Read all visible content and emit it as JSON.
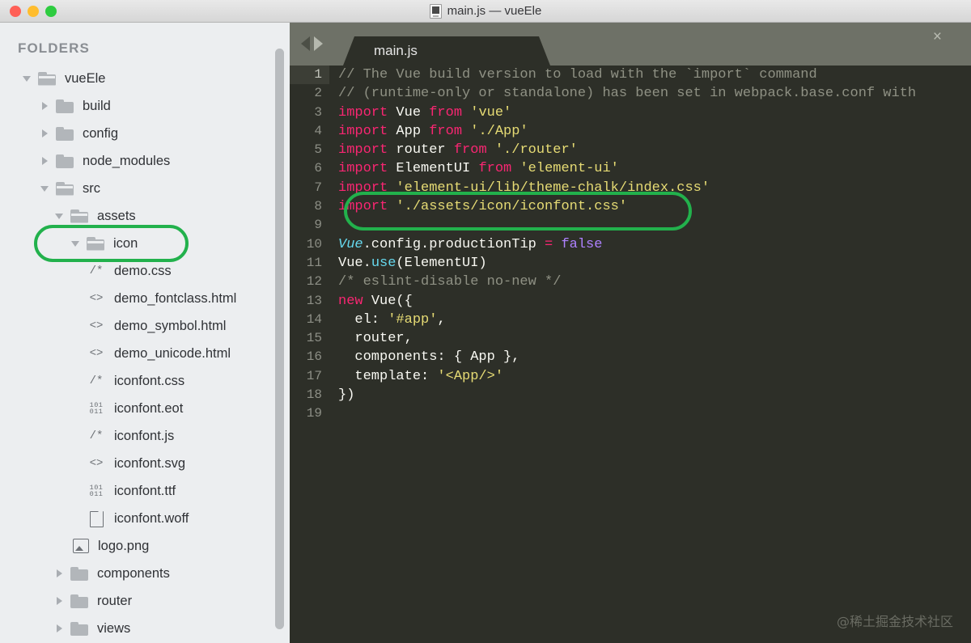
{
  "window": {
    "title": "main.js — vueEle",
    "title_icon": "document-icon",
    "traffic_lights": [
      {
        "name": "close",
        "color": "#ff5f56"
      },
      {
        "name": "minimize",
        "color": "#ffbd2e"
      },
      {
        "name": "zoom",
        "color": "#2ecc40"
      }
    ]
  },
  "sidebar": {
    "header": "FOLDERS",
    "tree": [
      {
        "label": "vueEle",
        "icon": "folder-open-icon",
        "twist": "down",
        "indent": 0
      },
      {
        "label": "build",
        "icon": "folder-icon",
        "twist": "right",
        "indent": 1
      },
      {
        "label": "config",
        "icon": "folder-icon",
        "twist": "right",
        "indent": 1
      },
      {
        "label": "node_modules",
        "icon": "folder-icon",
        "twist": "right",
        "indent": 1
      },
      {
        "label": "src",
        "icon": "folder-open-icon",
        "twist": "down",
        "indent": 1
      },
      {
        "label": "assets",
        "icon": "folder-open-icon",
        "twist": "down",
        "indent": 2
      },
      {
        "label": "icon",
        "icon": "folder-open-icon",
        "twist": "down",
        "indent": 3,
        "highlighted": true
      },
      {
        "label": "demo.css",
        "icon": "css-file-icon",
        "glyph": "/*",
        "indent": 4
      },
      {
        "label": "demo_fontclass.html",
        "icon": "html-file-icon",
        "glyph": "<>",
        "indent": 4
      },
      {
        "label": "demo_symbol.html",
        "icon": "html-file-icon",
        "glyph": "<>",
        "indent": 4
      },
      {
        "label": "demo_unicode.html",
        "icon": "html-file-icon",
        "glyph": "<>",
        "indent": 4
      },
      {
        "label": "iconfont.css",
        "icon": "css-file-icon",
        "glyph": "/*",
        "indent": 4
      },
      {
        "label": "iconfont.eot",
        "icon": "binary-file-icon",
        "glyph": "101 011",
        "indent": 4
      },
      {
        "label": "iconfont.js",
        "icon": "css-file-icon",
        "glyph": "/*",
        "indent": 4
      },
      {
        "label": "iconfont.svg",
        "icon": "html-file-icon",
        "glyph": "<>",
        "indent": 4
      },
      {
        "label": "iconfont.ttf",
        "icon": "binary-file-icon",
        "glyph": "101 011",
        "indent": 4
      },
      {
        "label": "iconfont.woff",
        "icon": "blank-file-icon",
        "glyph": "",
        "indent": 4
      },
      {
        "label": "logo.png",
        "icon": "image-file-icon",
        "glyph": "",
        "indent": 3
      },
      {
        "label": "components",
        "icon": "folder-icon",
        "twist": "right",
        "indent": 2
      },
      {
        "label": "router",
        "icon": "folder-icon",
        "twist": "right",
        "indent": 2
      },
      {
        "label": "views",
        "icon": "folder-icon",
        "twist": "right",
        "indent": 2
      }
    ]
  },
  "editor": {
    "nav_back_icon": "arrow-left-icon",
    "nav_forward_icon": "arrow-right-icon",
    "tab": {
      "label": "main.js",
      "close_icon": "close-icon",
      "close_glyph": "×"
    },
    "active_line": 1,
    "line_numbers": [
      1,
      2,
      3,
      4,
      5,
      6,
      7,
      8,
      9,
      10,
      11,
      12,
      13,
      14,
      15,
      16,
      17,
      18,
      19
    ],
    "lines": [
      [
        {
          "t": "com",
          "v": "// The Vue build version to load with the `import` command"
        }
      ],
      [
        {
          "t": "com",
          "v": "// (runtime-only or standalone) has been set in webpack.base.conf with"
        }
      ],
      [
        {
          "t": "kw",
          "v": "import "
        },
        {
          "t": "id",
          "v": "Vue "
        },
        {
          "t": "kw",
          "v": "from "
        },
        {
          "t": "str",
          "v": "'vue'"
        }
      ],
      [
        {
          "t": "kw",
          "v": "import "
        },
        {
          "t": "id",
          "v": "App "
        },
        {
          "t": "kw",
          "v": "from "
        },
        {
          "t": "str",
          "v": "'./App'"
        }
      ],
      [
        {
          "t": "kw",
          "v": "import "
        },
        {
          "t": "id",
          "v": "router "
        },
        {
          "t": "kw",
          "v": "from "
        },
        {
          "t": "str",
          "v": "'./router'"
        }
      ],
      [
        {
          "t": "kw",
          "v": "import "
        },
        {
          "t": "id",
          "v": "ElementUI "
        },
        {
          "t": "kw",
          "v": "from "
        },
        {
          "t": "str",
          "v": "'element-ui'"
        }
      ],
      [
        {
          "t": "kw",
          "v": "import "
        },
        {
          "t": "str",
          "v": "'element-ui/lib/theme-chalk/index.css'"
        }
      ],
      [
        {
          "t": "kw",
          "v": "import "
        },
        {
          "t": "str",
          "v": "'./assets/icon/iconfont.css'"
        }
      ],
      [],
      [
        {
          "t": "cls",
          "v": "Vue"
        },
        {
          "t": "pl",
          "v": ".config.productionTip "
        },
        {
          "t": "kw",
          "v": "= "
        },
        {
          "t": "num",
          "v": "false"
        }
      ],
      [
        {
          "t": "pl",
          "v": "Vue."
        },
        {
          "t": "fn",
          "v": "use"
        },
        {
          "t": "pl",
          "v": "(ElementUI)"
        }
      ],
      [
        {
          "t": "com",
          "v": "/* eslint-disable no-new */"
        }
      ],
      [
        {
          "t": "kw",
          "v": "new "
        },
        {
          "t": "pl",
          "v": "Vue({"
        }
      ],
      [
        {
          "t": "pl",
          "v": "  el: "
        },
        {
          "t": "str",
          "v": "'#app'"
        },
        {
          "t": "pl",
          "v": ","
        }
      ],
      [
        {
          "t": "pl",
          "v": "  router,"
        }
      ],
      [
        {
          "t": "pl",
          "v": "  components: { App },"
        }
      ],
      [
        {
          "t": "pl",
          "v": "  template: "
        },
        {
          "t": "str",
          "v": "'<App/>'"
        }
      ],
      [
        {
          "t": "pl",
          "v": "})"
        }
      ],
      []
    ]
  },
  "annotations": {
    "accent_color": "#22b14c",
    "boxes": [
      {
        "name": "icon-folder-highlight",
        "target": "icon"
      },
      {
        "name": "iconfont-import-highlight",
        "target": "import './assets/icon/iconfont.css'"
      }
    ]
  },
  "watermark": {
    "text": "@稀土掘金技术社区"
  },
  "colors": {
    "sidebar_bg": "#eceef0",
    "editor_bg": "#2d2f28",
    "tabbar_bg": "#6e7167",
    "keyword": "#f92672",
    "string": "#e6db74",
    "comment": "#8f9184",
    "class": "#66d9ef",
    "number": "#ae81ff",
    "plain": "#f8f8f2"
  }
}
